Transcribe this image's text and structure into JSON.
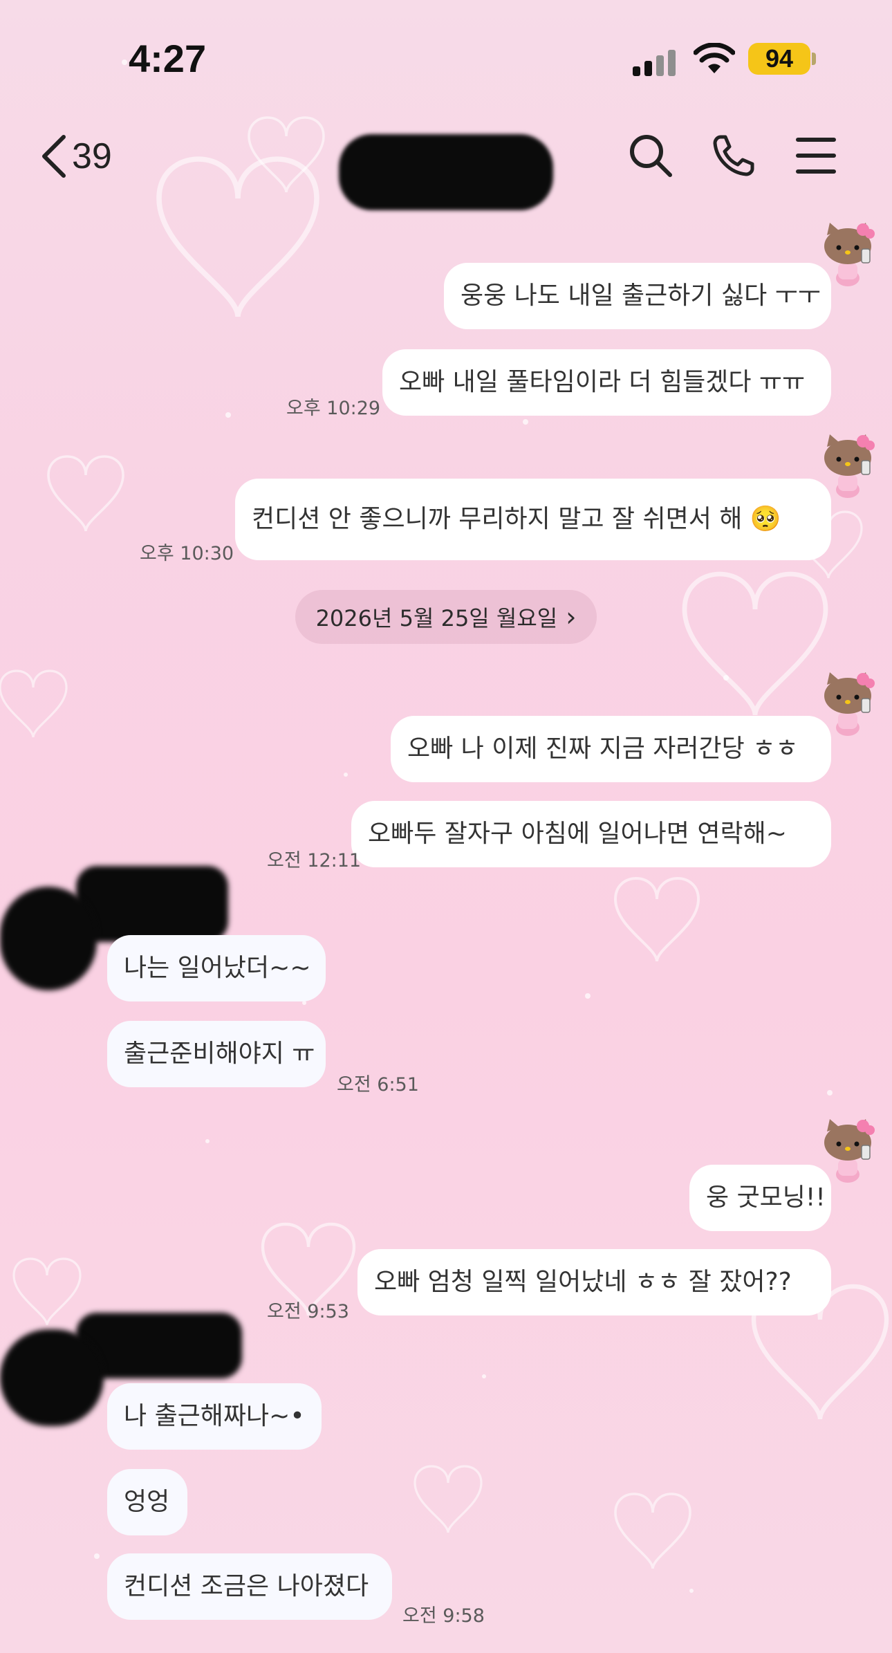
{
  "status_bar": {
    "time": "4:27",
    "battery": "94"
  },
  "nav": {
    "back_count": "39"
  },
  "colors": {
    "background": "#f9d3e4",
    "bubble": "#ffffff",
    "battery": "#f5c518"
  },
  "icons": [
    "chevron-left-icon",
    "search-icon",
    "phone-icon",
    "menu-icon",
    "signal-icon",
    "wifi-icon",
    "avatar-hello-kitty-icon"
  ],
  "date_divider": {
    "label": "2026년 5월 25일 월요일",
    "chevron": "›"
  },
  "messages": [
    {
      "text": "웅웅 나도 내일 출근하기 싫다 ㅜㅜ"
    },
    {
      "text": "오빠 내일 풀타임이라 더 힘들겠다 ㅠㅠ",
      "time": "오후 10:29"
    },
    {
      "text": "컨디션 안 좋으니까 무리하지 말고 잘 쉬면서 해 🥺",
      "time": "오후 10:30"
    },
    {
      "text": "오빠 나 이제 진짜 지금 자러간당 ㅎㅎ"
    },
    {
      "text": "오빠두 잘자구 아침에 일어나면 연락해~",
      "time": "오전 12:11"
    },
    {
      "text": "나는 일어났더~~"
    },
    {
      "text": "출근준비해야지 ㅠ",
      "time": "오전 6:51"
    },
    {
      "text": "웅 굿모닝!!"
    },
    {
      "text": "오빠 엄청 일찍 일어났네 ㅎㅎ 잘 잤어??",
      "time": "오전 9:53"
    },
    {
      "text": "나 출근해짜나~•"
    },
    {
      "text": "엉엉"
    },
    {
      "text": "컨디션 조금은 나아졌다",
      "time": "오전 9:58"
    }
  ]
}
